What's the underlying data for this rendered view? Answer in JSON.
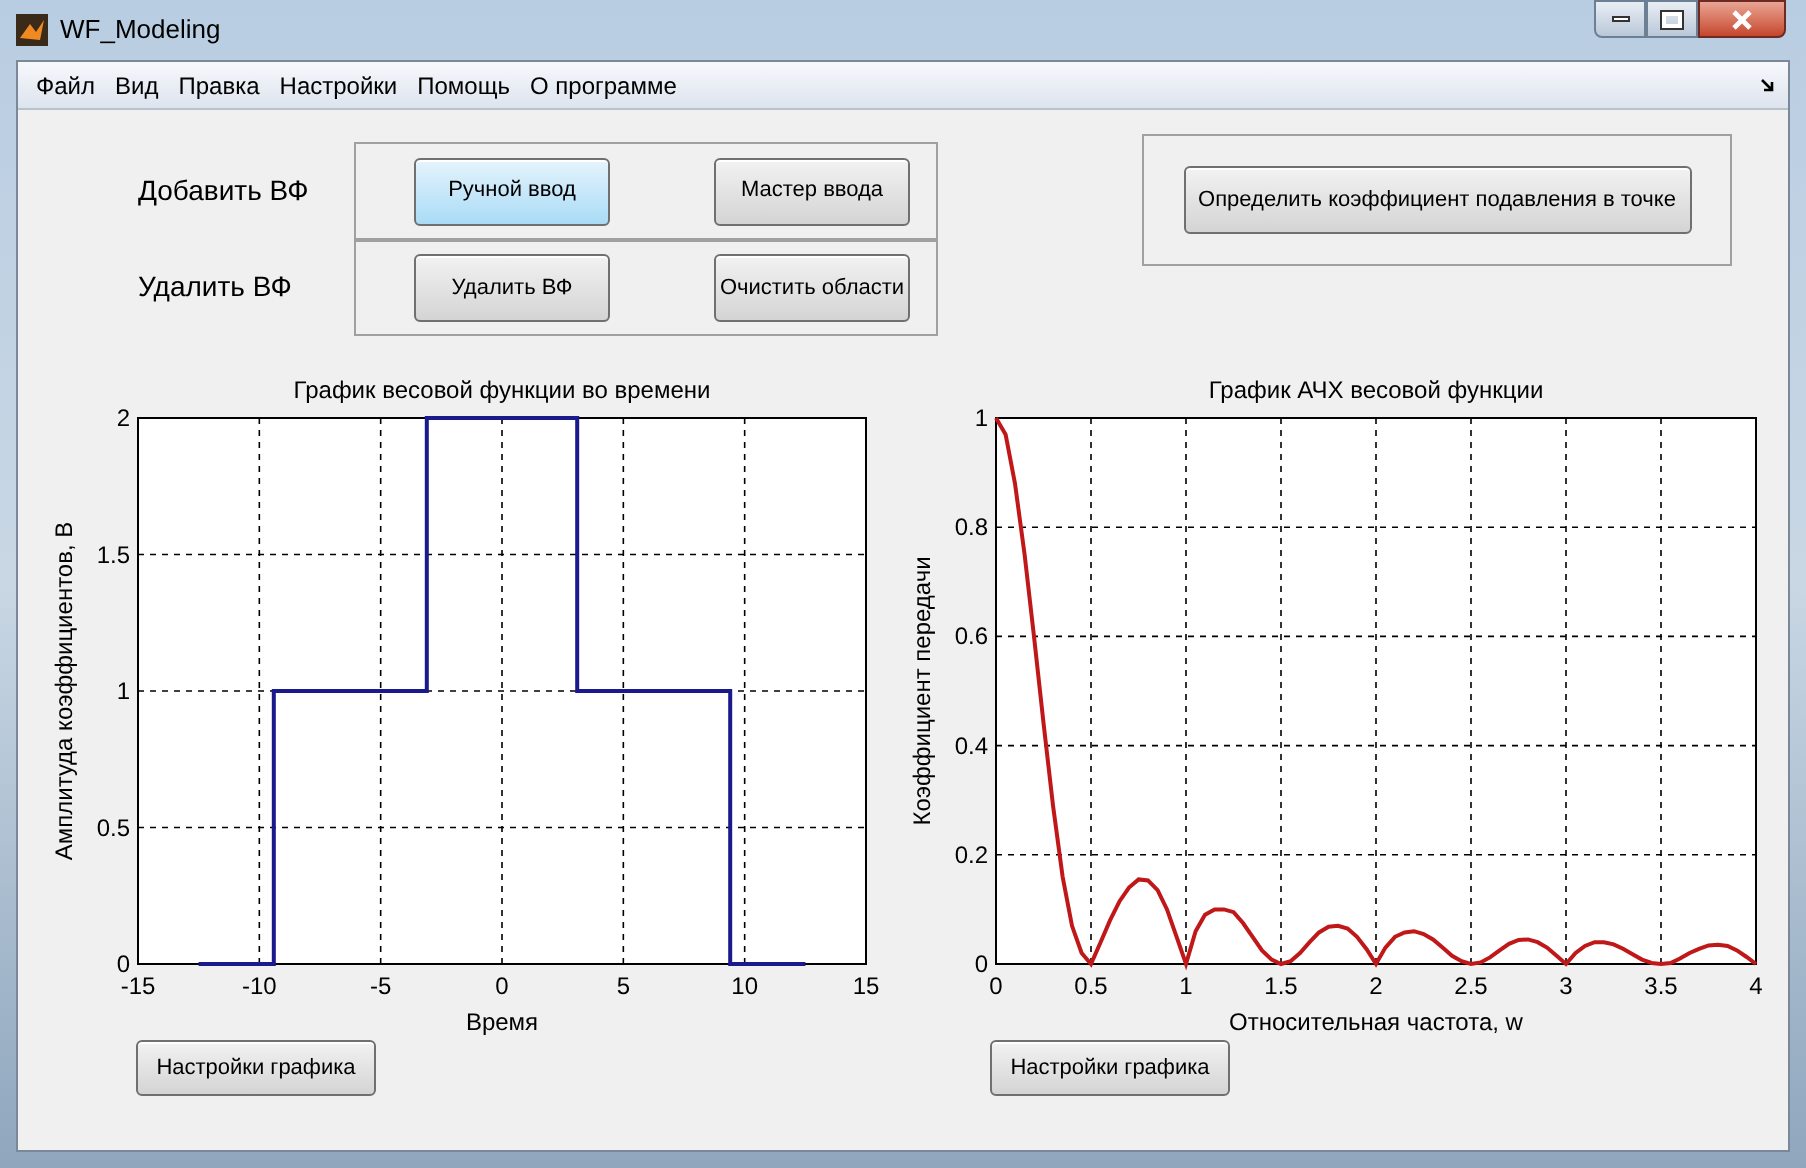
{
  "window": {
    "title": "WF_Modeling"
  },
  "menu": [
    "Файл",
    "Вид",
    "Правка",
    "Настройки",
    "Помощь",
    "О программе"
  ],
  "rows": [
    {
      "label": "Добавить ВФ",
      "buttons": [
        {
          "label": "Ручной ввод",
          "selected": true
        },
        {
          "label": "Мастер ввода",
          "selected": false
        }
      ]
    },
    {
      "label": "Удалить ВФ",
      "buttons": [
        {
          "label": "Удалить ВФ",
          "selected": false
        },
        {
          "label": "Очистить области",
          "selected": false
        }
      ]
    }
  ],
  "suppression_button": "Определить коэффициент подавления в точке",
  "charts": [
    {
      "settings_button": "Настройки графика",
      "chart_data": {
        "type": "line",
        "title": "График весовой функции во времени",
        "xlabel": "Время",
        "ylabel": "Амплитуда коэффициентов, В",
        "xlim": [
          -15,
          15
        ],
        "ylim": [
          0,
          2
        ],
        "xticks": [
          -15,
          -10,
          -5,
          0,
          5,
          10,
          15
        ],
        "yticks": [
          0,
          0.5,
          1,
          1.5,
          2
        ],
        "x": [
          -12.5,
          -9.4,
          -9.4,
          -3.1,
          -3.1,
          3.1,
          3.1,
          9.4,
          9.4,
          12.5
        ],
        "grid": true,
        "series": [
          {
            "color": "#1a1a8c",
            "values": [
              0,
              0,
              1,
              1,
              2,
              2,
              1,
              1,
              0,
              0
            ]
          }
        ]
      }
    },
    {
      "settings_button": "Настройки графика",
      "chart_data": {
        "type": "line",
        "title": "График АЧХ весовой функции",
        "xlabel": "Относительная частота, w",
        "ylabel": "Коэффициент передачи",
        "xlim": [
          0,
          4
        ],
        "ylim": [
          0,
          1
        ],
        "xticks": [
          0,
          0.5,
          1,
          1.5,
          2,
          2.5,
          3,
          3.5,
          4
        ],
        "yticks": [
          0,
          0.2,
          0.4,
          0.6,
          0.8,
          1
        ],
        "x": [
          0,
          0.05,
          0.1,
          0.15,
          0.2,
          0.25,
          0.3,
          0.35,
          0.4,
          0.45,
          0.5,
          0.55,
          0.6,
          0.65,
          0.7,
          0.75,
          0.8,
          0.85,
          0.9,
          0.95,
          1,
          1.05,
          1.1,
          1.15,
          1.2,
          1.25,
          1.3,
          1.35,
          1.4,
          1.45,
          1.5,
          1.55,
          1.6,
          1.65,
          1.7,
          1.75,
          1.8,
          1.85,
          1.9,
          1.95,
          2,
          2.05,
          2.1,
          2.15,
          2.2,
          2.25,
          2.3,
          2.35,
          2.4,
          2.45,
          2.5,
          2.55,
          2.6,
          2.65,
          2.7,
          2.75,
          2.8,
          2.85,
          2.9,
          2.95,
          3,
          3.05,
          3.1,
          3.15,
          3.2,
          3.25,
          3.3,
          3.35,
          3.4,
          3.45,
          3.5,
          3.55,
          3.6,
          3.65,
          3.7,
          3.75,
          3.8,
          3.85,
          3.9,
          3.95,
          4
        ],
        "grid": true,
        "series": [
          {
            "color": "#c01818",
            "values": [
              1,
              0.97,
              0.88,
              0.75,
              0.6,
              0.44,
              0.29,
              0.16,
              0.07,
              0.02,
              0,
              0.04,
              0.08,
              0.115,
              0.14,
              0.155,
              0.153,
              0.135,
              0.1,
              0.05,
              0,
              0.06,
              0.09,
              0.1,
              0.1,
              0.095,
              0.075,
              0.05,
              0.025,
              0.008,
              0,
              0.005,
              0.02,
              0.04,
              0.058,
              0.068,
              0.07,
              0.065,
              0.05,
              0.027,
              0,
              0.03,
              0.05,
              0.058,
              0.06,
              0.055,
              0.045,
              0.03,
              0.015,
              0.005,
              0,
              0.003,
              0.012,
              0.025,
              0.037,
              0.044,
              0.045,
              0.04,
              0.03,
              0.015,
              0,
              0.02,
              0.033,
              0.04,
              0.04,
              0.036,
              0.028,
              0.018,
              0.008,
              0.002,
              0,
              0.002,
              0.01,
              0.02,
              0.028,
              0.034,
              0.035,
              0.033,
              0.025,
              0.013,
              0
            ]
          }
        ]
      }
    }
  ]
}
